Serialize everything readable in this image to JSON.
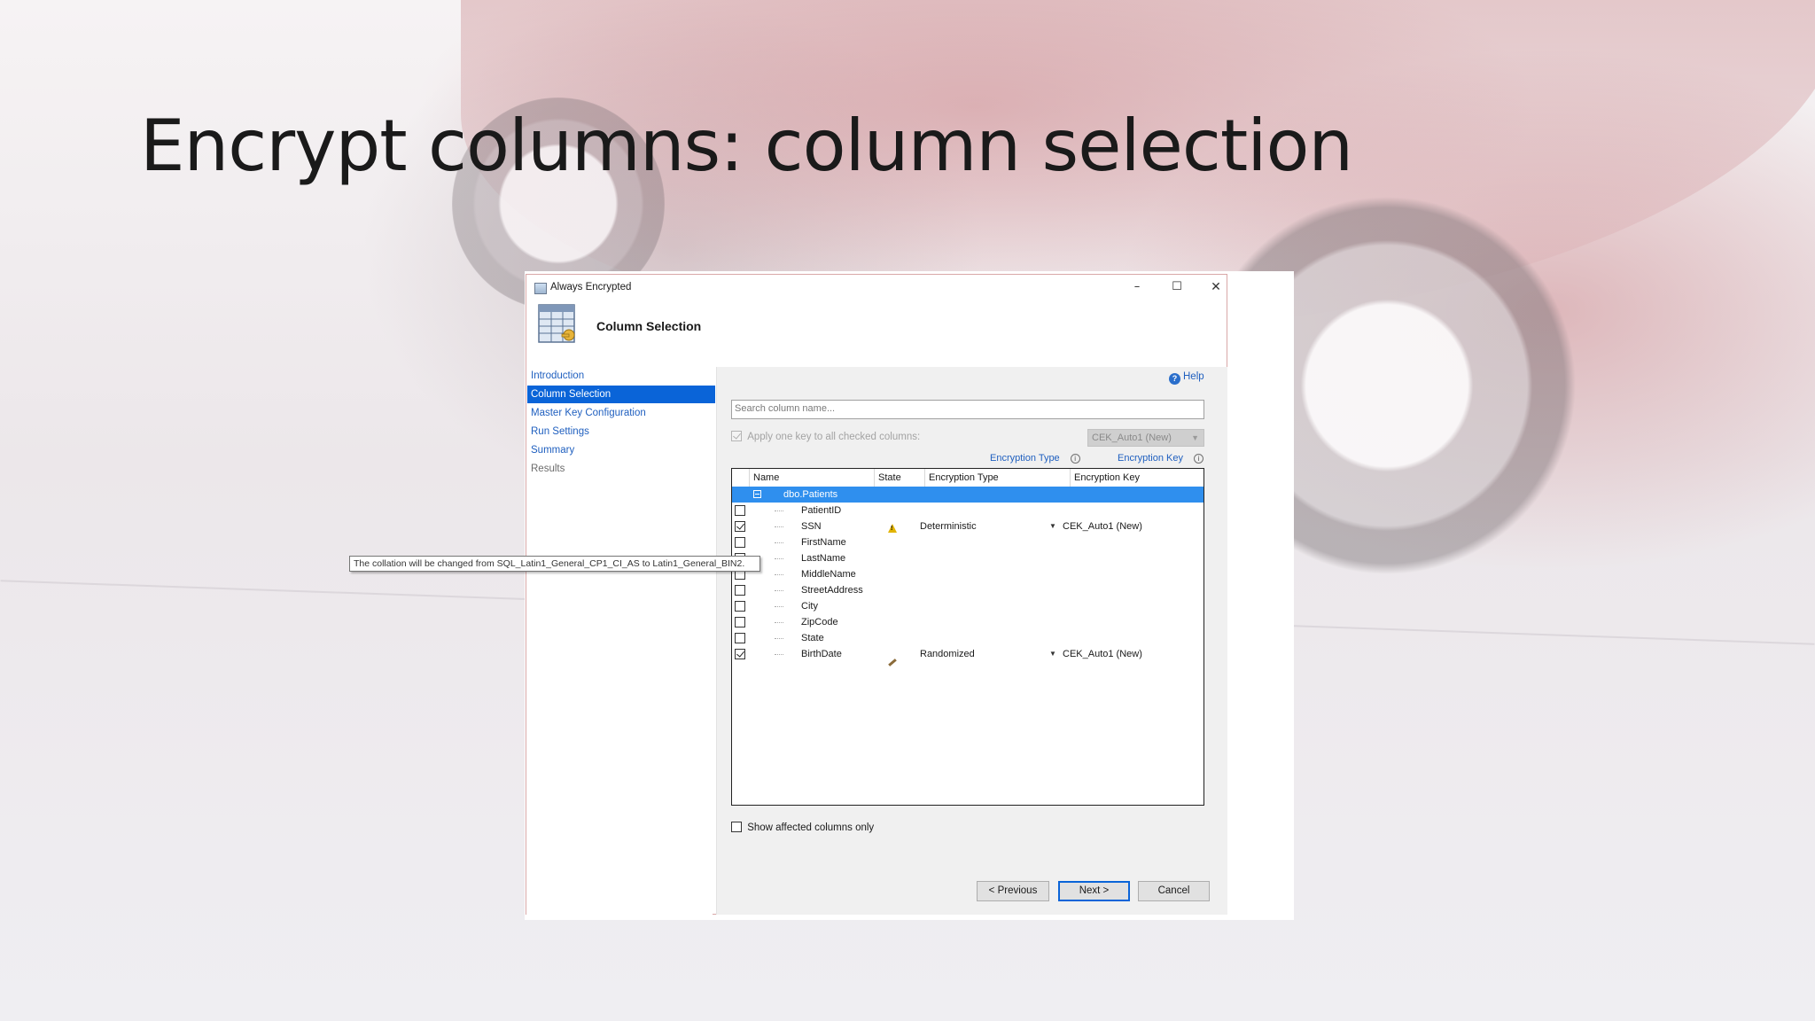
{
  "slide": {
    "title": "Encrypt columns: column selection"
  },
  "window": {
    "title": "Always Encrypted",
    "minimize": "–",
    "maximize": "☐",
    "close": "✕"
  },
  "header": {
    "title": "Column Selection"
  },
  "nav": [
    {
      "label": "Introduction",
      "state": "link"
    },
    {
      "label": "Column Selection",
      "state": "active"
    },
    {
      "label": "Master Key Configuration",
      "state": "link"
    },
    {
      "label": "Run Settings",
      "state": "link"
    },
    {
      "label": "Summary",
      "state": "link"
    },
    {
      "label": "Results",
      "state": "disabled"
    }
  ],
  "help": {
    "label": "Help"
  },
  "search": {
    "placeholder": "Search column name..."
  },
  "apply_key": {
    "label": "Apply one key to all checked columns:",
    "checked": true,
    "key": "CEK_Auto1 (New)"
  },
  "labels": {
    "encryption_type": "Encryption Type",
    "encryption_key": "Encryption Key"
  },
  "grid": {
    "columns": [
      "Name",
      "State",
      "Encryption Type",
      "Encryption Key"
    ],
    "group": "dbo.Patients",
    "rows": [
      {
        "name": "PatientID",
        "checked": false,
        "state": "",
        "type": "",
        "key": ""
      },
      {
        "name": "SSN",
        "checked": true,
        "state": "warning",
        "type": "Deterministic",
        "key": "CEK_Auto1 (New)"
      },
      {
        "name": "FirstName",
        "checked": false,
        "state": "",
        "type": "",
        "key": ""
      },
      {
        "name": "LastName",
        "checked": false,
        "state": "",
        "type": "",
        "key": ""
      },
      {
        "name": "MiddleName",
        "checked": false,
        "state": "",
        "type": "",
        "key": ""
      },
      {
        "name": "StreetAddress",
        "checked": false,
        "state": "",
        "type": "",
        "key": ""
      },
      {
        "name": "City",
        "checked": false,
        "state": "",
        "type": "",
        "key": ""
      },
      {
        "name": "ZipCode",
        "checked": false,
        "state": "",
        "type": "",
        "key": ""
      },
      {
        "name": "State",
        "checked": false,
        "state": "",
        "type": "",
        "key": ""
      },
      {
        "name": "BirthDate",
        "checked": true,
        "state": "edit",
        "type": "Randomized",
        "key": "CEK_Auto1 (New)"
      }
    ]
  },
  "tooltip": "The collation will be changed from SQL_Latin1_General_CP1_CI_AS to Latin1_General_BIN2.",
  "show_affected": {
    "label": "Show affected columns only",
    "checked": false
  },
  "buttons": {
    "previous": "< Previous",
    "next": "Next >",
    "cancel": "Cancel"
  },
  "colors": {
    "accent": "#0a64d8",
    "link": "#1f5fbf",
    "group_row": "#2f8fee"
  }
}
